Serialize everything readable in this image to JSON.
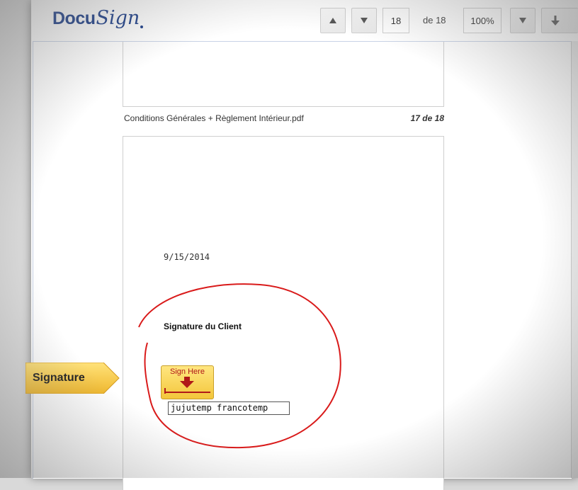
{
  "app": {
    "logo_docu": "Docu",
    "logo_sign": "Sign"
  },
  "toolbar": {
    "prev_page_icon": "triangle-up-icon",
    "next_page_icon": "triangle-down-icon",
    "current_page": "18",
    "page_of_label": "de 18",
    "zoom_value": "100%",
    "zoom_dropdown_icon": "triangle-down-icon",
    "download_icon": "download-arrow-icon"
  },
  "document": {
    "filename": "Conditions Générales + Règlement Intérieur.pdf",
    "page_indicator": "17 de 18",
    "date": "9/15/2014",
    "signature_heading": "Signature du Client",
    "sign_here_label": "Sign Here",
    "signer_name": "jujutemp francotemp"
  },
  "signature_tab": {
    "label": "Signature"
  },
  "colors": {
    "brand": "#1d3f8a",
    "sign_here_fill": "#f3c63b",
    "sign_here_text": "#b01818",
    "annotation_circle": "#d91a1a",
    "signature_tab_fill": "#f5c842"
  }
}
